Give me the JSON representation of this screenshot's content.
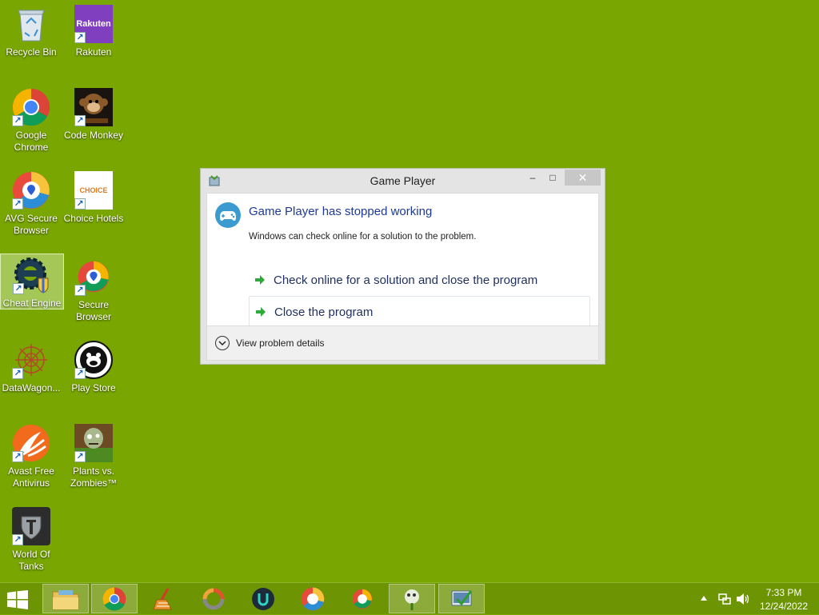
{
  "desktop": {
    "icons": [
      {
        "label": "Recycle Bin"
      },
      {
        "label": "Rakuten",
        "logo_text": "Rakuten"
      },
      {
        "label": "Google Chrome"
      },
      {
        "label": "Code Monkey"
      },
      {
        "label": "AVG Secure Browser"
      },
      {
        "label": "Choice Hotels",
        "logo_text": "CHOICE"
      },
      {
        "label": "Cheat Engine"
      },
      {
        "label": "Secure Browser"
      },
      {
        "label": "DataWagon..."
      },
      {
        "label": "Play Store"
      },
      {
        "label": "Avast Free Antivirus"
      },
      {
        "label": "Plants vs. Zombies™"
      },
      {
        "label": "World Of Tanks"
      }
    ]
  },
  "dialog": {
    "title": "Game Player",
    "minimize_glyph": "–",
    "maximize_glyph": "□",
    "close_glyph": "✕",
    "heading": "Game Player has stopped working",
    "subtext": "Windows can check online for a solution to the problem.",
    "actions": [
      {
        "label": "Check online for a solution and close the program"
      },
      {
        "label": "Close the program"
      }
    ],
    "details_label": "View problem details"
  },
  "taskbar": {
    "time": "7:33 PM",
    "date": "12/24/2022"
  },
  "colors": {
    "desktop_bg": "#79a600",
    "taskbar_bg": "#6c9403",
    "link_blue": "#1d3a99",
    "arrow_green": "#2eaa3a"
  }
}
